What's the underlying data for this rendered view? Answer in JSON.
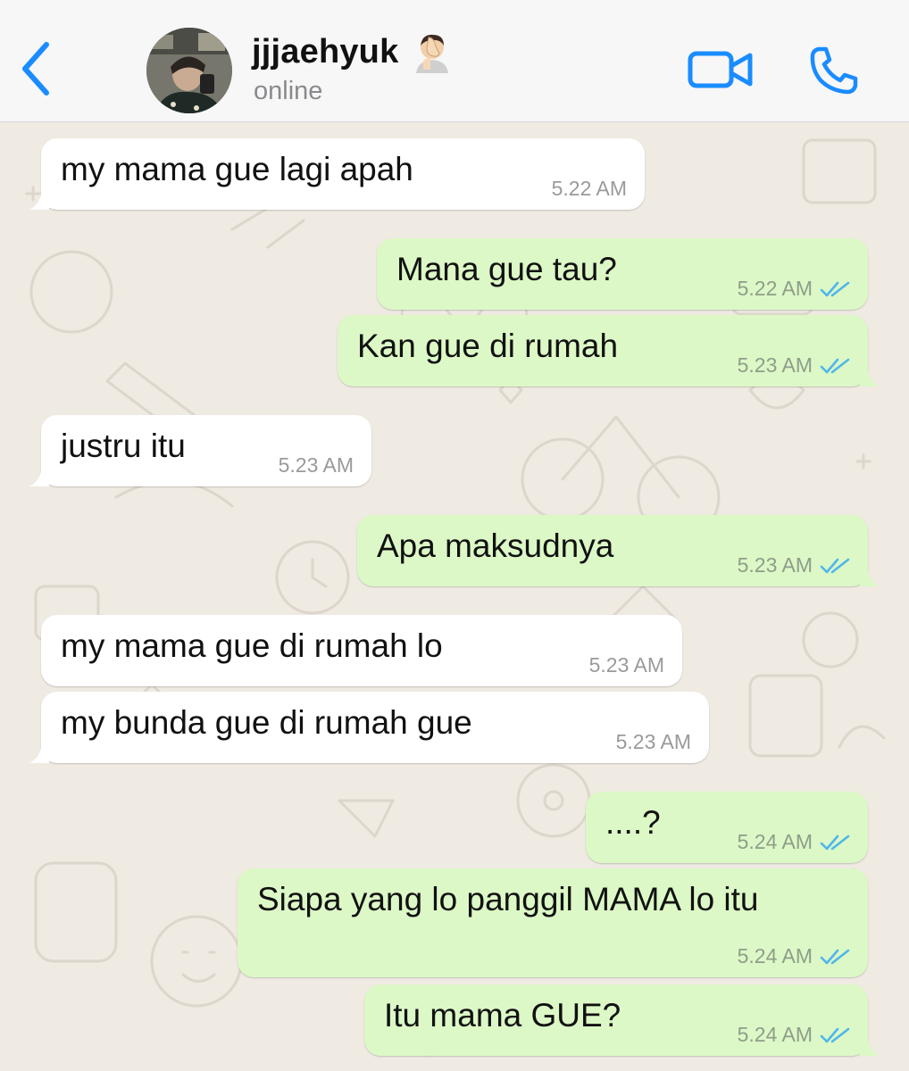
{
  "header": {
    "contact_name": "jjjaehyuk",
    "status": "online",
    "accent_color": "#1a8cff",
    "icons": [
      "back-chevron-icon",
      "avatar",
      "facepalm-emoji-icon",
      "video-call-icon",
      "phone-call-icon"
    ]
  },
  "messages": [
    {
      "text": "my mama gue lagi apah",
      "time": "5.22 AM",
      "direction": "incoming"
    },
    {
      "text": "Mana gue tau?",
      "time": "5.22 AM",
      "direction": "outgoing",
      "read": true
    },
    {
      "text": "Kan gue di rumah",
      "time": "5.23 AM",
      "direction": "outgoing",
      "read": true
    },
    {
      "text": "justru itu",
      "time": "5.23 AM",
      "direction": "incoming"
    },
    {
      "text": "Apa maksudnya",
      "time": "5.23 AM",
      "direction": "outgoing",
      "read": true
    },
    {
      "text": "my mama gue di rumah lo",
      "time": "5.23 AM",
      "direction": "incoming"
    },
    {
      "text": "my bunda gue di rumah gue",
      "time": "5.23 AM",
      "direction": "incoming"
    },
    {
      "text": "....?",
      "time": "5.24 AM",
      "direction": "outgoing",
      "read": true
    },
    {
      "text": "Siapa yang lo panggil MAMA lo itu",
      "time": "5.24 AM",
      "direction": "outgoing",
      "read": true
    },
    {
      "text": "Itu mama GUE?",
      "time": "5.24 AM",
      "direction": "outgoing",
      "read": true
    }
  ],
  "colors": {
    "incoming_bubble": "#ffffff",
    "outgoing_bubble": "#dcf8c6",
    "read_ticks": "#4fb6ec",
    "wallpaper": "#efeae2"
  }
}
